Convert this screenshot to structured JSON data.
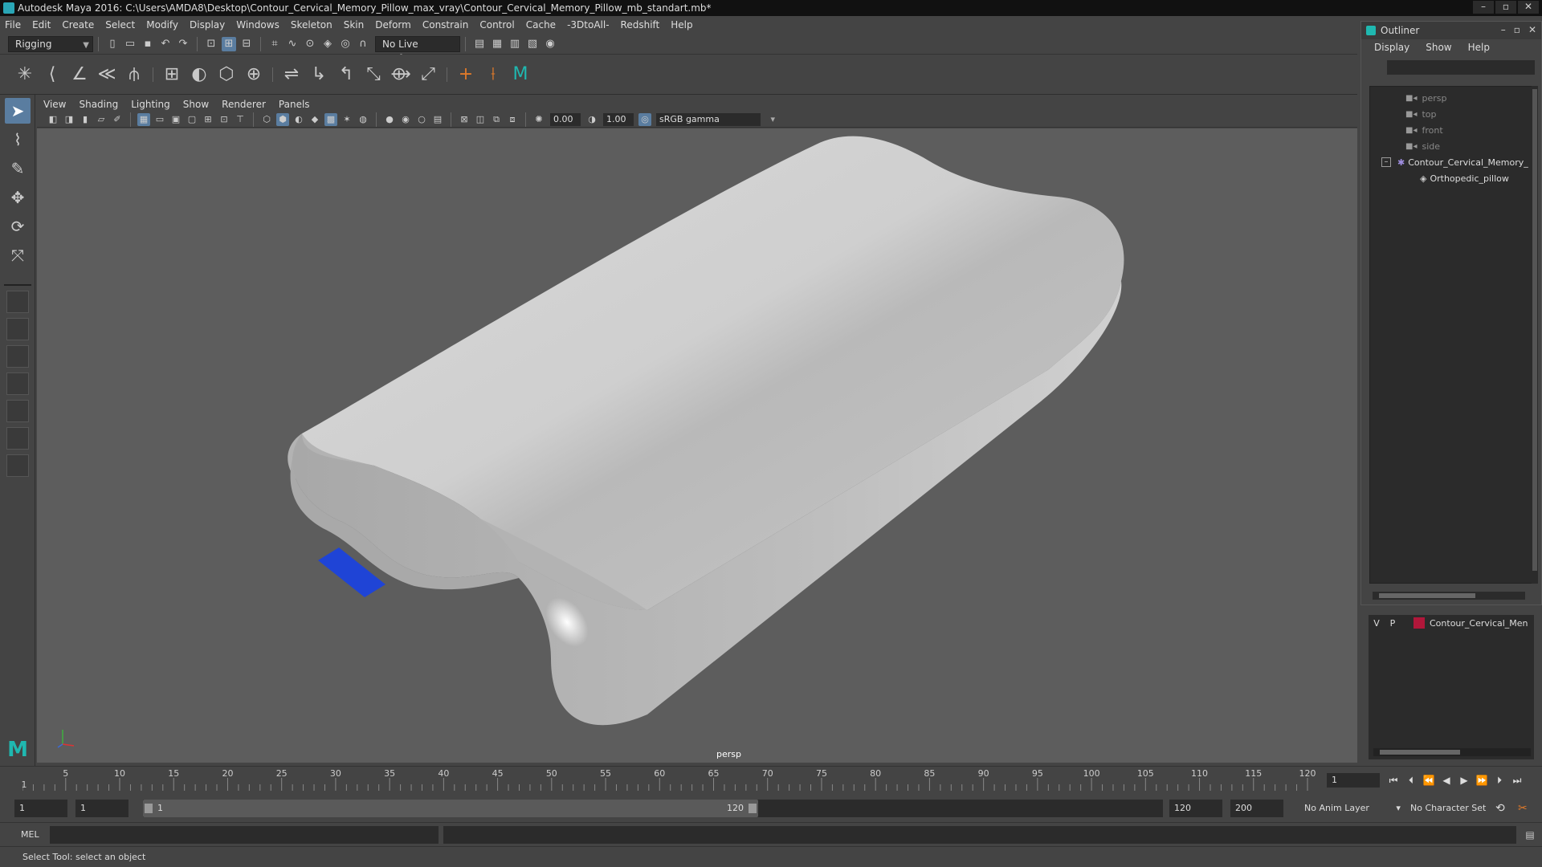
{
  "window": {
    "title": "Autodesk Maya 2016: C:\\Users\\AMDA8\\Desktop\\Contour_Cervical_Memory_Pillow_max_vray\\Contour_Cervical_Memory_Pillow_mb_standart.mb*"
  },
  "menubar": [
    "File",
    "Edit",
    "Create",
    "Select",
    "Modify",
    "Display",
    "Windows",
    "Skeleton",
    "Skin",
    "Deform",
    "Constrain",
    "Control",
    "Cache",
    "-3DtoAll-",
    "Redshift",
    "Help"
  ],
  "status_line": {
    "mode": "Rigging",
    "live_surface": "No Live Surface"
  },
  "panel": {
    "menus": [
      "View",
      "Shading",
      "Lighting",
      "Show",
      "Renderer",
      "Panels"
    ],
    "exposure": "0.00",
    "gamma": "1.00",
    "color_space": "sRGB gamma",
    "camera_label": "persp"
  },
  "outliner": {
    "title": "Outliner",
    "menus": [
      "Display",
      "Show",
      "Help"
    ],
    "items": [
      {
        "label": "persp",
        "type": "camera"
      },
      {
        "label": "top",
        "type": "camera"
      },
      {
        "label": "front",
        "type": "camera"
      },
      {
        "label": "side",
        "type": "camera"
      },
      {
        "label": "Contour_Cervical_Memory_",
        "type": "group"
      },
      {
        "label": "Orthopedic_pillow",
        "type": "mesh"
      }
    ]
  },
  "layers": {
    "rows": [
      {
        "v": "V",
        "p": "P",
        "name": "Contour_Cervical_Men",
        "color": "#b0173a"
      }
    ]
  },
  "timeline": {
    "ticks": [
      5,
      10,
      15,
      20,
      25,
      30,
      35,
      40,
      45,
      50,
      55,
      60,
      65,
      70,
      75,
      80,
      85,
      90,
      95,
      100,
      105,
      110,
      115,
      120
    ],
    "range_start": 1,
    "range_end": 120,
    "start_marker": "1",
    "current_frame": "1"
  },
  "range": {
    "start_field": "1",
    "inner_start": "1",
    "handle_start": "1",
    "handle_end": "120",
    "end_field": "120",
    "outer_end": "200",
    "anim_layer": "No Anim Layer",
    "character_set": "No Character Set"
  },
  "cmdline": {
    "lang": "MEL"
  },
  "help_line": "Select Tool: select an object",
  "colors": {
    "viewport_bg": "#5d5d5d",
    "accent": "#5a7da0",
    "layer_swatch": "#b0173a",
    "blue_tag": "#1f44d6"
  }
}
